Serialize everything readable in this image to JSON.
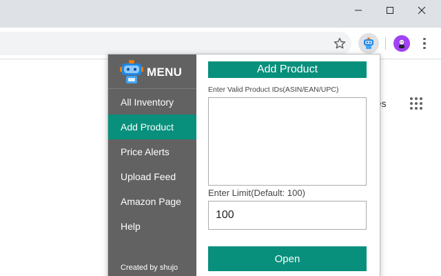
{
  "colors": {
    "accent": "#08907c",
    "sidebar": "#626262",
    "titlebar": "#dee1e6"
  },
  "window_controls": {
    "minimize": "minimize-icon",
    "maximize": "maximize-icon",
    "close": "close-icon"
  },
  "toolbar": {
    "bookmark_icon": "star-icon",
    "extension_icon": "robot-extension-icon",
    "profile_icon": "profile-avatar-icon",
    "menu_icon": "kebab-menu-icon"
  },
  "background_page": {
    "partial_text": "ges",
    "apps_icon": "apps-grid-icon"
  },
  "popup": {
    "menu": {
      "logo_icon": "robot-logo-icon",
      "title": "MENU",
      "items": [
        {
          "label": "All Inventory",
          "active": false
        },
        {
          "label": "Add Product",
          "active": true
        },
        {
          "label": "Price Alerts",
          "active": false
        },
        {
          "label": "Upload Feed",
          "active": false
        },
        {
          "label": "Amazon Page",
          "active": false
        },
        {
          "label": "Help",
          "active": false
        }
      ],
      "footer": "Created by shujo"
    },
    "content": {
      "title": "Add Product",
      "ids_label": "Enter Valid Product IDs(ASIN/EAN/UPC)",
      "ids_value": "",
      "limit_label": "Enter Limit(Default: 100)",
      "limit_value": "100",
      "open_button": "Open"
    }
  }
}
